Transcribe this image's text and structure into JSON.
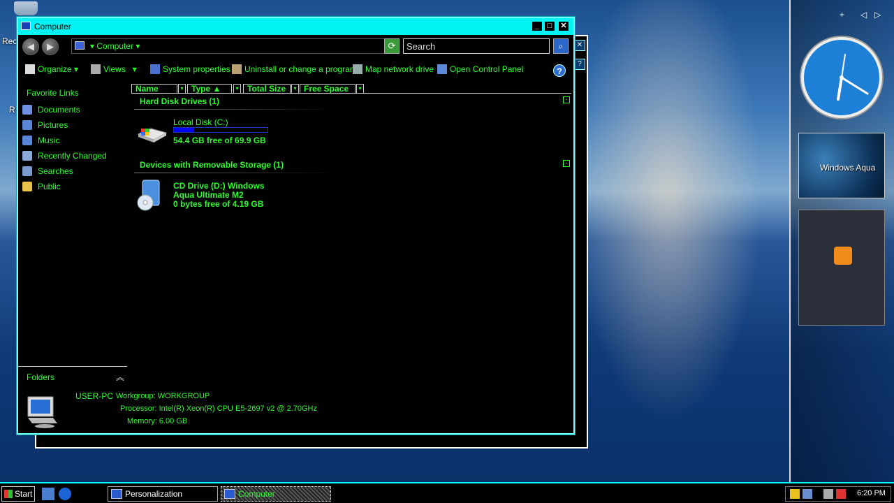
{
  "window": {
    "title": "Computer",
    "minimize": "_",
    "maximize": "□",
    "close": "✕"
  },
  "address": {
    "path": "Computer",
    "search_placeholder": "Search"
  },
  "toolbar": {
    "organize": "Organize",
    "views": "Views",
    "system_properties": "System properties",
    "uninstall": "Uninstall or change a program",
    "map_network": "Map network drive",
    "control_panel": "Open Control Panel",
    "help": "?"
  },
  "sidebar": {
    "favorite_links_title": "Favorite Links",
    "links": [
      {
        "label": "Documents",
        "icon": "documents-icon",
        "color": "#6f8fe0"
      },
      {
        "label": "Pictures",
        "icon": "pictures-icon",
        "color": "#5a86d6"
      },
      {
        "label": "Music",
        "icon": "music-icon",
        "color": "#5a86d6"
      },
      {
        "label": "Recently Changed",
        "icon": "recent-icon",
        "color": "#8aa8d8"
      },
      {
        "label": "Searches",
        "icon": "searches-icon",
        "color": "#7a9ad0"
      },
      {
        "label": "Public",
        "icon": "public-folder-icon",
        "color": "#e8c34a"
      }
    ],
    "folders_label": "Folders"
  },
  "columns": [
    {
      "label": "Name"
    },
    {
      "label": "Type"
    },
    {
      "label": "Total Size"
    },
    {
      "label": "Free Space"
    }
  ],
  "groups": {
    "hard_disk": "Hard Disk Drives (1)",
    "removable": "Devices with Removable Storage (1)"
  },
  "drives": {
    "local_name": "Local Disk (C:)",
    "local_free": "54.4 GB free of 69.9 GB",
    "local_used_fraction": 0.22,
    "cd_line1": "CD Drive (D:) Windows",
    "cd_line2": "Aqua Ultimate M2",
    "cd_free": "0 bytes free of 4.19 GB"
  },
  "details": {
    "computer_name": "USER-PC",
    "workgroup": "Workgroup: WORKGROUP",
    "processor": "Processor: Intel(R) Xeon(R) CPU E5-2697 v2 @ 2.70GHz",
    "memory": "Memory: 6.00 GB"
  },
  "gadgets": {
    "aqua_label": "Windows Aqua",
    "add": "+",
    "prev": "◁",
    "next": "▷"
  },
  "desktop": {
    "icon_label_1": "Rec",
    "icon_label_2": "R"
  },
  "taskbar": {
    "start": "Start",
    "tasks": [
      {
        "label": "Personalization"
      },
      {
        "label": "Computer"
      }
    ],
    "time": "6:20 PM"
  },
  "colors": {
    "accent": "#00f2f2",
    "text": "#2aff2a"
  }
}
